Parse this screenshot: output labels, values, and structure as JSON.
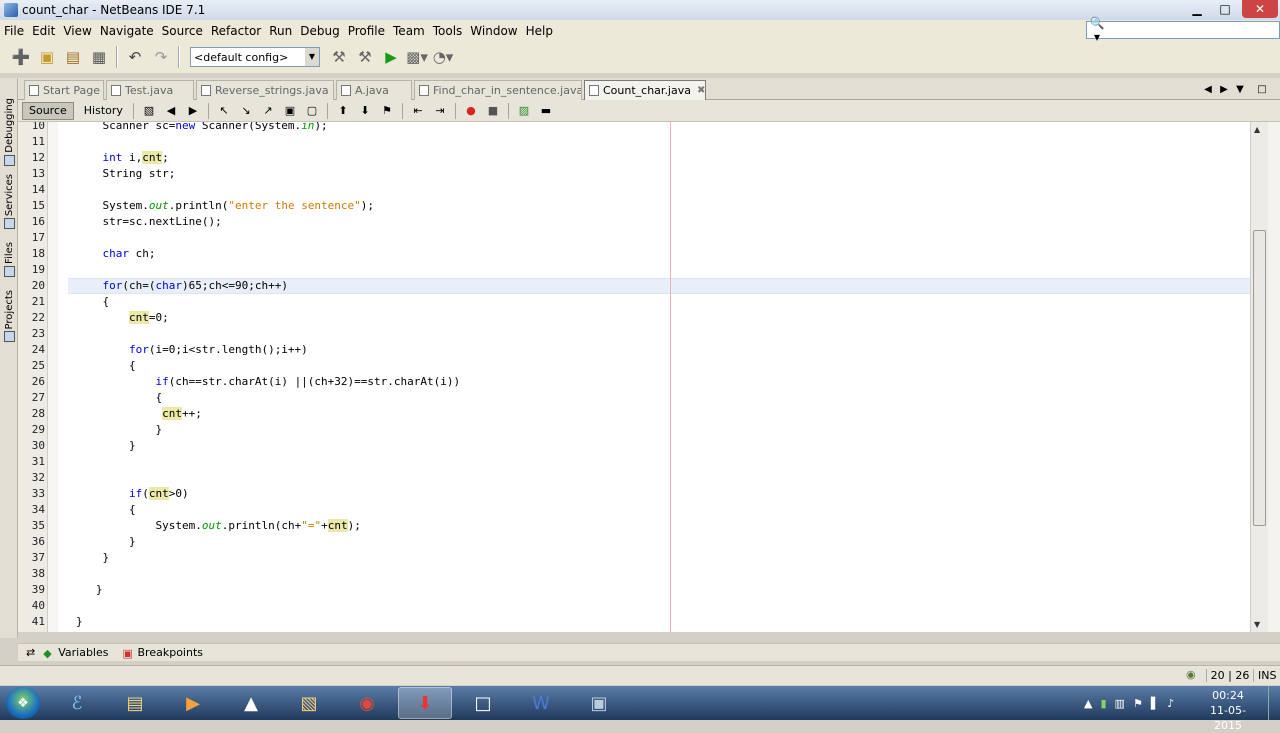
{
  "window": {
    "title": "count_char - NetBeans IDE 7.1"
  },
  "menu": [
    "File",
    "Edit",
    "View",
    "Navigate",
    "Source",
    "Refactor",
    "Run",
    "Debug",
    "Profile",
    "Team",
    "Tools",
    "Window",
    "Help"
  ],
  "search": {
    "placeholder": ""
  },
  "toolbar": {
    "config": "<default config>"
  },
  "left_tabs": [
    "Debugging",
    "Services",
    "Files",
    "Projects"
  ],
  "tabs": [
    {
      "label": "Start Page",
      "active": false
    },
    {
      "label": "Test.java",
      "active": false
    },
    {
      "label": "Reverse_strings.java",
      "active": false
    },
    {
      "label": "A.java",
      "active": false
    },
    {
      "label": "Find_char_in_sentence.java",
      "active": false
    },
    {
      "label": "Count_char.java",
      "active": true
    }
  ],
  "editor_toolbar": {
    "source": "Source",
    "history": "History"
  },
  "code_lines": [
    {
      "n": "10",
      "t": "    Scanner sc=new Scanner(System.in);"
    },
    {
      "n": "11",
      "t": ""
    },
    {
      "n": "12",
      "t": "    int i,cnt;"
    },
    {
      "n": "13",
      "t": "    String str;"
    },
    {
      "n": "14",
      "t": ""
    },
    {
      "n": "15",
      "t": "    System.out.println(\"enter the sentence\");"
    },
    {
      "n": "16",
      "t": "    str=sc.nextLine();"
    },
    {
      "n": "17",
      "t": ""
    },
    {
      "n": "18",
      "t": "    char ch;"
    },
    {
      "n": "19",
      "t": ""
    },
    {
      "n": "20",
      "t": "    for(ch=(char)65;ch<=90;ch++)"
    },
    {
      "n": "21",
      "t": "    {"
    },
    {
      "n": "22",
      "t": "        cnt=0;"
    },
    {
      "n": "23",
      "t": ""
    },
    {
      "n": "24",
      "t": "        for(i=0;i<str.length();i++)"
    },
    {
      "n": "25",
      "t": "        {"
    },
    {
      "n": "26",
      "t": "            if(ch==str.charAt(i) ||(ch+32)==str.charAt(i))"
    },
    {
      "n": "27",
      "t": "            {"
    },
    {
      "n": "28",
      "t": "             cnt++;"
    },
    {
      "n": "29",
      "t": "            }"
    },
    {
      "n": "30",
      "t": "        }"
    },
    {
      "n": "31",
      "t": ""
    },
    {
      "n": "32",
      "t": ""
    },
    {
      "n": "33",
      "t": "        if(cnt>0)"
    },
    {
      "n": "34",
      "t": "        {"
    },
    {
      "n": "35",
      "t": "            System.out.println(ch+\"=\"+cnt);"
    },
    {
      "n": "36",
      "t": "        }"
    },
    {
      "n": "37",
      "t": "    }"
    },
    {
      "n": "38",
      "t": ""
    },
    {
      "n": "39",
      "t": "   }"
    },
    {
      "n": "40",
      "t": ""
    },
    {
      "n": "41",
      "t": "}"
    }
  ],
  "bottom_panels": {
    "variables": "Variables",
    "breakpoints": "Breakpoints"
  },
  "status": {
    "position": "20 | 26",
    "mode": "INS"
  },
  "taskbar": {
    "time": "00:24",
    "date": "11-05-2015"
  }
}
